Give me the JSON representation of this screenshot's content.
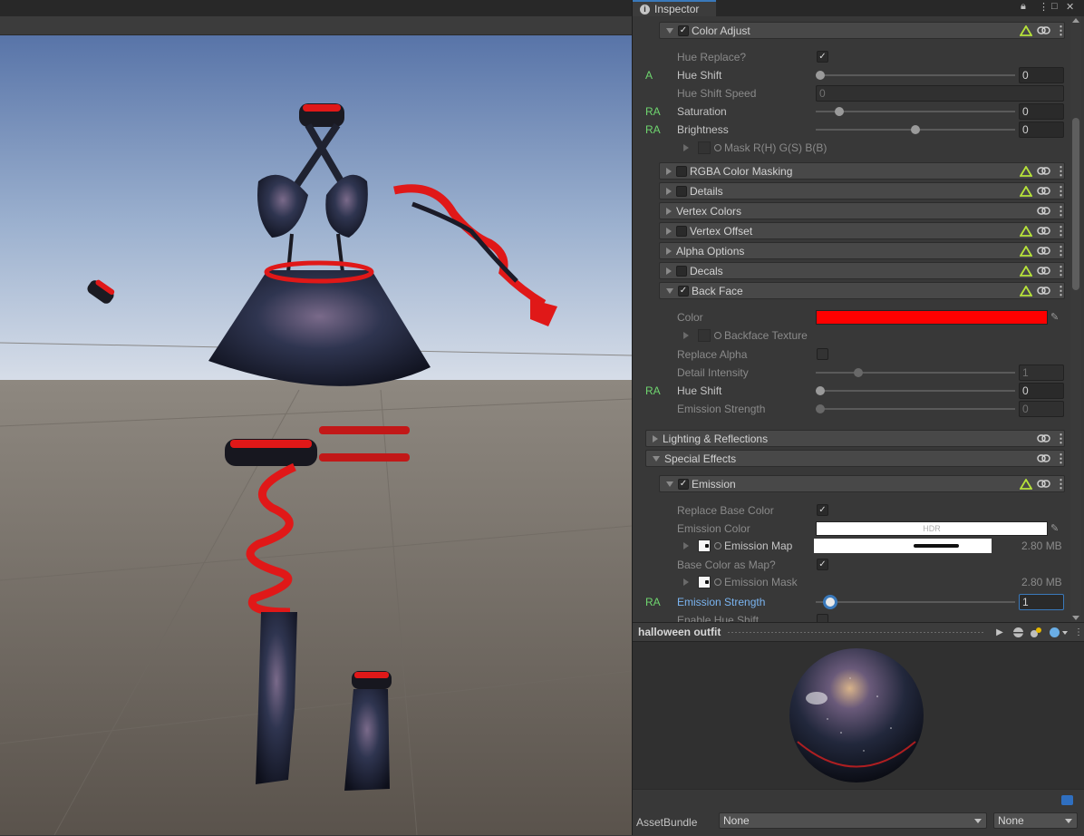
{
  "inspector": {
    "tab_label": "Inspector",
    "sections": {
      "color_adjust": "Color Adjust",
      "rgba_masking": "RGBA Color Masking",
      "details": "Details",
      "vertex_colors": "Vertex Colors",
      "vertex_offset": "Vertex Offset",
      "alpha_options": "Alpha Options",
      "decals": "Decals",
      "back_face": "Back Face",
      "lighting": "Lighting & Reflections",
      "special_effects": "Special Effects",
      "emission": "Emission"
    },
    "color_adjust": {
      "hue_replace": "Hue Replace?",
      "hue_shift_badge": "A",
      "hue_shift": "Hue Shift",
      "hue_shift_value": "0",
      "hue_shift_speed": "Hue Shift Speed",
      "hue_shift_speed_value": "0",
      "saturation_badge": "RA",
      "saturation": "Saturation",
      "saturation_value": "0",
      "saturation_level": 0.1,
      "brightness_badge": "RA",
      "brightness": "Brightness",
      "brightness_value": "0",
      "brightness_level": 0.5,
      "mask_label": "Mask R(H) G(S) B(B)"
    },
    "back_face": {
      "color_label": "Color",
      "color_value": "#ff0000",
      "backface_texture": "Backface Texture",
      "replace_alpha": "Replace Alpha",
      "detail_intensity": "Detail Intensity",
      "detail_intensity_value": "1",
      "detail_intensity_level": 0.2,
      "hue_shift_badge": "RA",
      "hue_shift": "Hue Shift",
      "hue_shift_value": "0",
      "emission_strength": "Emission Strength",
      "emission_strength_value": "0"
    },
    "emission": {
      "replace_base_color": "Replace Base Color",
      "emission_color": "Emission Color",
      "hdr_label": "HDR",
      "emission_map": "Emission Map",
      "emission_map_size": "2.80 MB",
      "base_color_as_map": "Base Color as Map?",
      "emission_mask": "Emission Mask",
      "emission_mask_size": "2.80 MB",
      "emission_strength_badge": "RA",
      "emission_strength": "Emission Strength",
      "emission_strength_value": "1",
      "emission_strength_level": 0.05,
      "enable_hue_shift": "Enable Hue Shift"
    },
    "preview": {
      "material_name": "halloween outfit"
    },
    "asset_bundle": {
      "label": "AssetBundle",
      "name_value": "None",
      "variant_value": "None"
    }
  },
  "colors": {
    "accent_blue": "#3a79bb",
    "badge_green": "#6fd66f",
    "backface_red": "#ff0000"
  }
}
